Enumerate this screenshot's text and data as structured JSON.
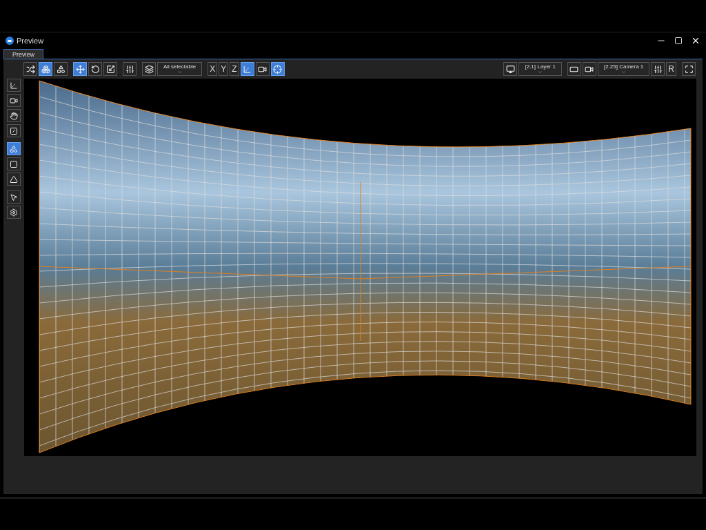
{
  "window": {
    "title": "Preview"
  },
  "tabs": [
    {
      "label": "Preview",
      "selected": true
    }
  ],
  "toolbar_left": [
    {
      "kind": "icon",
      "selected": false
    },
    {
      "kind": "icon",
      "selected": true
    },
    {
      "kind": "icon",
      "selected": false
    },
    {
      "kind": "gap"
    },
    {
      "kind": "icon",
      "selected": true
    },
    {
      "kind": "icon",
      "selected": false
    },
    {
      "kind": "icon",
      "selected": false
    },
    {
      "kind": "gap"
    },
    {
      "kind": "icon",
      "selected": false
    },
    {
      "kind": "gap"
    },
    {
      "kind": "icon",
      "selected": false
    },
    {
      "kind": "dropdown",
      "label": "All selectable"
    },
    {
      "kind": "gap"
    },
    {
      "kind": "text",
      "label": "X",
      "selected": false
    },
    {
      "kind": "text",
      "label": "Y",
      "selected": false
    },
    {
      "kind": "text",
      "label": "Z",
      "selected": false
    },
    {
      "kind": "icon",
      "selected": true
    },
    {
      "kind": "icon",
      "selected": false
    },
    {
      "kind": "icon",
      "selected": true
    }
  ],
  "toolbar_right": [
    {
      "kind": "icon",
      "selected": false
    },
    {
      "kind": "dropdown",
      "label": "[2.1] Layer 1"
    },
    {
      "kind": "gap"
    },
    {
      "kind": "icon",
      "selected": false
    },
    {
      "kind": "icon",
      "selected": false
    },
    {
      "kind": "dropdown",
      "label": "[2.25] Camera 1"
    },
    {
      "kind": "icon",
      "selected": false
    },
    {
      "kind": "text",
      "label": "R",
      "selected": false
    },
    {
      "kind": "gap"
    },
    {
      "kind": "icon",
      "selected": false
    }
  ],
  "side_tools": [
    {
      "selected": false
    },
    {
      "selected": false
    },
    {
      "selected": false
    },
    {
      "selected": false
    },
    {
      "selected": true
    },
    {
      "selected": false
    },
    {
      "selected": false
    },
    {
      "selected": false
    },
    {
      "selected": false
    }
  ]
}
